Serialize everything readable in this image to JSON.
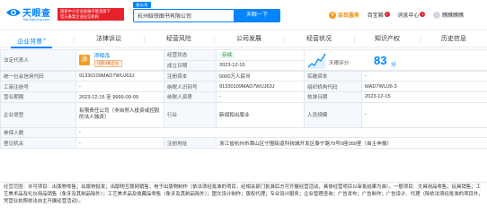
{
  "header": {
    "logo_name": "天眼查",
    "logo_domain": "TianYanCha.com",
    "endorse_line1": "国家中小企业发展子基金旗下",
    "endorse_line2": "官方备案企业征信机构",
    "search_tab": "查公司",
    "search_value": "杭州晗铁图书有限公司",
    "search_button": "天眼一下",
    "nav": {
      "vip_icon": "V",
      "vip": "会员服务",
      "baijia": "百宝箱",
      "baijia_badge": "1",
      "messages": "消息中心",
      "messages_badge": "1",
      "username": "瞧瞧瞧瞧"
    }
  },
  "tabs": [
    {
      "label": "企业背景",
      "count": "4",
      "active": true
    },
    {
      "label": "法律诉讼",
      "count": ""
    },
    {
      "label": "经营风险",
      "count": ""
    },
    {
      "label": "公司发展",
      "count": ""
    },
    {
      "label": "经营状况",
      "count": ""
    },
    {
      "label": "知识产权",
      "count": ""
    },
    {
      "label": "历史信息",
      "count": ""
    }
  ],
  "info": {
    "rep_key": "法定代表人",
    "rep_avatar": "添",
    "rep_name": "添榀泓",
    "rep_tag": "任职3家企业",
    "status_key": "经营状态",
    "status_val": "存续",
    "founded_key": "成立日期",
    "founded_val": "2023-12-15",
    "score_key": "天眼评分",
    "score_val": "83",
    "score_unit": "分",
    "credit_key": "统一社会信用代码",
    "credit_val": "91330109MAD7WUJ63J",
    "reg_cap_key": "注册资本",
    "reg_cap_val": "5000万人民币",
    "paid_cap_key": "实缴资本",
    "paid_cap_val": "-",
    "biz_reg_key": "工商注册号",
    "biz_reg_val": "-",
    "tax_key": "纳税人识别号",
    "tax_val": "91330109MAD7WUJ63J",
    "org_key": "组织机构代码",
    "org_val": "MAD7WUJ6-3",
    "term_key": "营业期限",
    "term_val": "2023-12-15 至 9999-09-09",
    "taxq_key": "纳税人资质",
    "taxq_val": "-",
    "approve_key": "核准日期",
    "approve_val": "2023-12-15",
    "type_key": "企业类型",
    "type_val": "有限责任公司（非自然人投资或控股的法人独资）",
    "industry_key": "行业",
    "industry_val": "新闻和出版业",
    "staff_key": "人员规模",
    "staff_val": "-",
    "insured_key": "参保人数",
    "insured_val": "-",
    "authority_key": "登记机关",
    "authority_val": "-",
    "address_key": "注册地址",
    "address_val": "浙江省杭州市萧山区宁围街道科技城开发区泰宁路79号0座359室（自主申报）",
    "scope_key": "经营范围",
    "scope_val": "许可项目：出版物零售；出版物批发；出版物互联网销售；电子出版物制作（依法须经批准的项目，经相关部门批准后方可开展经营活动，具体经营项目以审批结果为准）。一般项目：文具用品零售；玩具销售；工艺美术品及礼仪用品销售（象牙及其制品除外）；工艺美术品及收藏品零售（象牙及其制品除外）；图文设计制作；版权代理；专业设计服务；企业管理咨询；广告发布；广告制作；广告设计、代理（除依法须经批准的项目外，凭营业执照依法自主开展经营活动）。"
  },
  "colors": {
    "brand": "#0084ff",
    "status_ok": "#21a14a",
    "accent_orange": "#f0a020",
    "badge_red": "#e62129"
  }
}
